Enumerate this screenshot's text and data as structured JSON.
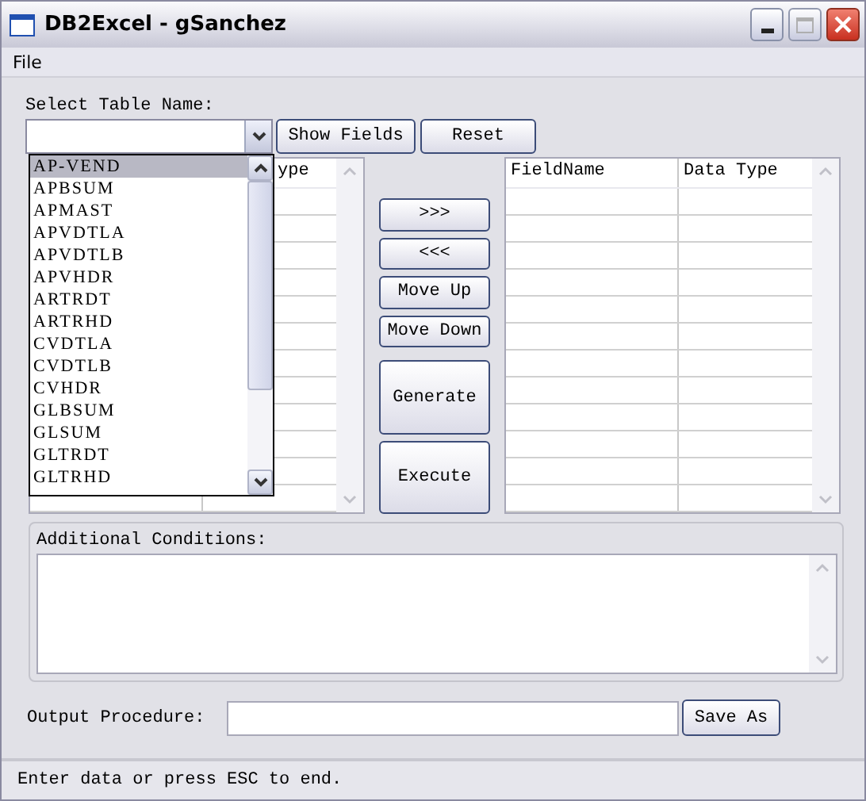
{
  "window": {
    "title": "DB2Excel - gSanchez"
  },
  "menu": [
    "File"
  ],
  "table_select": {
    "label": "Select Table Name:",
    "expanded": true,
    "items": [
      {
        "label": "AP-VEND",
        "selected": true
      },
      {
        "label": "APBSUM",
        "selected": false
      },
      {
        "label": "APMAST",
        "selected": false
      },
      {
        "label": "APVDTLA",
        "selected": false
      },
      {
        "label": "APVDTLB",
        "selected": false
      },
      {
        "label": "APVHDR",
        "selected": false
      },
      {
        "label": "ARTRDT",
        "selected": false
      },
      {
        "label": "ARTRHD",
        "selected": false
      },
      {
        "label": "CVDTLA",
        "selected": false
      },
      {
        "label": "CVDTLB",
        "selected": false
      },
      {
        "label": "CVHDR",
        "selected": false
      },
      {
        "label": "GLBSUM",
        "selected": false
      },
      {
        "label": "GLSUM",
        "selected": false
      },
      {
        "label": "GLTRDT",
        "selected": false
      },
      {
        "label": "GLTRHD",
        "selected": false
      }
    ]
  },
  "top_buttons": [
    "Show Fields",
    "Reset"
  ],
  "source_grid": {
    "columns": [
      "ype"
    ]
  },
  "move_buttons": [
    ">>>",
    "<<<",
    "Move Up",
    "Move Down"
  ],
  "action_buttons": [
    "Generate",
    "Execute"
  ],
  "target_grid": {
    "columns": [
      "FieldName",
      "Data Type"
    ]
  },
  "conditions": {
    "label": "Additional Conditions:"
  },
  "output": {
    "label": "Output Procedure:",
    "button": "Save As"
  },
  "status_bar": "Enter data or press ESC to end."
}
